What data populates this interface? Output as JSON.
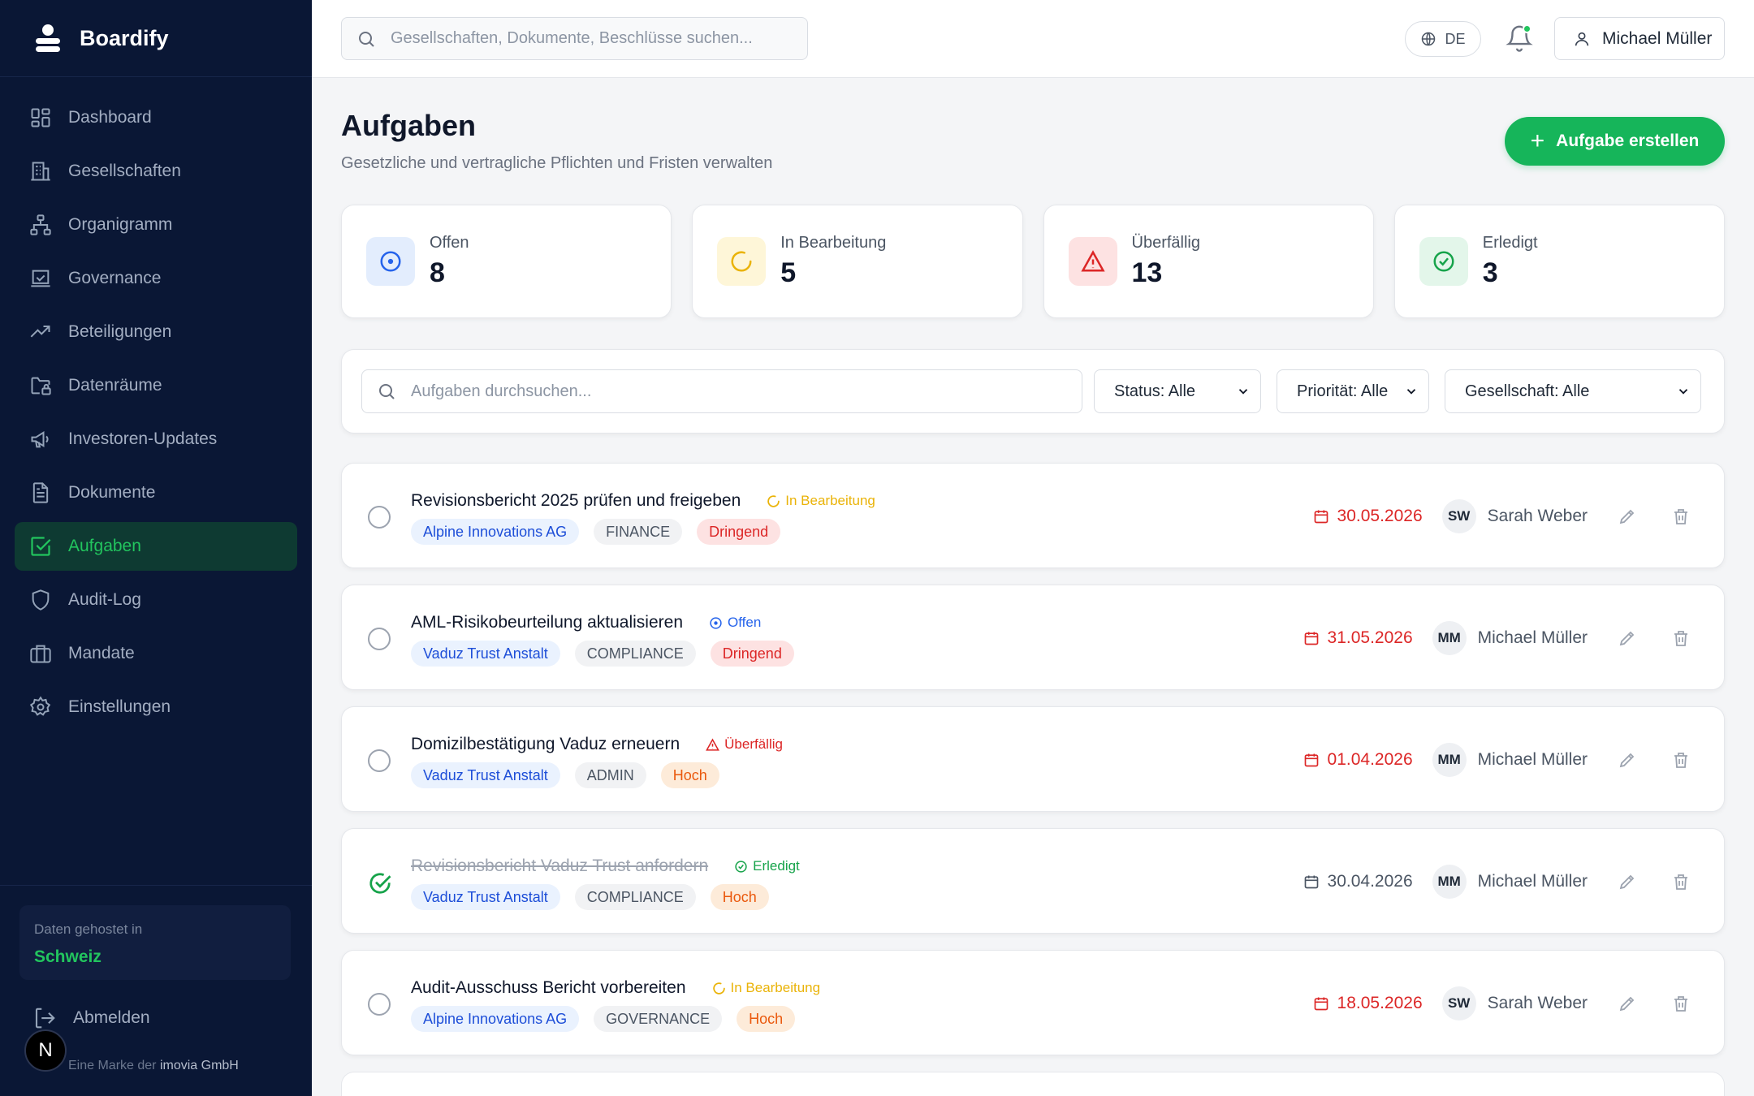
{
  "app": {
    "name": "Boardify"
  },
  "sidebar": {
    "items": [
      {
        "label": "Dashboard",
        "icon": "dashboard-icon"
      },
      {
        "label": "Gesellschaften",
        "icon": "building-icon"
      },
      {
        "label": "Organigramm",
        "icon": "org-chart-icon"
      },
      {
        "label": "Governance",
        "icon": "governance-icon"
      },
      {
        "label": "Beteiligungen",
        "icon": "trending-up-icon"
      },
      {
        "label": "Datenräume",
        "icon": "folder-lock-icon"
      },
      {
        "label": "Investoren-Updates",
        "icon": "megaphone-icon"
      },
      {
        "label": "Dokumente",
        "icon": "document-icon"
      },
      {
        "label": "Aufgaben",
        "icon": "checkbox-icon",
        "active": true
      },
      {
        "label": "Audit-Log",
        "icon": "shield-icon"
      },
      {
        "label": "Mandate",
        "icon": "briefcase-icon"
      },
      {
        "label": "Einstellungen",
        "icon": "gear-icon"
      }
    ],
    "hosting_label": "Daten gehostet in",
    "hosting_value": "Schweiz",
    "logout_label": "Abmelden",
    "brandline_prefix": "Eine Marke der",
    "brandline_company": "imovia GmbH",
    "badge_letter": "N"
  },
  "topbar": {
    "search_placeholder": "Gesellschaften, Dokumente, Beschlüsse suchen...",
    "language": "DE",
    "user_name": "Michael Müller"
  },
  "page": {
    "title": "Aufgaben",
    "subtitle": "Gesetzliche und vertragliche Pflichten und Fristen verwalten",
    "create_button": "Aufgabe erstellen"
  },
  "stats": [
    {
      "label": "Offen",
      "value": "8",
      "icon": "target-icon",
      "color": "#2563eb",
      "bg": "#e3edfd"
    },
    {
      "label": "In Bearbeitung",
      "value": "5",
      "icon": "loader-icon",
      "color": "#eab308",
      "bg": "#fef6d8"
    },
    {
      "label": "Überfällig",
      "value": "13",
      "icon": "alert-triangle-icon",
      "color": "#dc2626",
      "bg": "#fde2e2"
    },
    {
      "label": "Erledigt",
      "value": "3",
      "icon": "check-circle-icon",
      "color": "#16a34a",
      "bg": "#e3f6ea"
    }
  ],
  "filters": {
    "search_placeholder": "Aufgaben durchsuchen...",
    "status": "Status: Alle",
    "priority": "Priorität: Alle",
    "company": "Gesellschaft: Alle"
  },
  "tasks": [
    {
      "title": "Revisionsbericht 2025 prüfen und freigeben",
      "status": "In Bearbeitung",
      "status_color": "#eab308",
      "company": "Alpine Innovations AG",
      "category": "FINANCE",
      "priority": "Dringend",
      "due": "30.05.2026",
      "due_overdue": true,
      "initials": "SW",
      "assignee": "Sarah Weber",
      "done": false
    },
    {
      "title": "AML-Risikobeurteilung aktualisieren",
      "status": "Offen",
      "status_color": "#2563eb",
      "company": "Vaduz Trust Anstalt",
      "category": "COMPLIANCE",
      "priority": "Dringend",
      "due": "31.05.2026",
      "due_overdue": true,
      "initials": "MM",
      "assignee": "Michael Müller",
      "done": false
    },
    {
      "title": "Domizilbestätigung Vaduz erneuern",
      "status": "Überfällig",
      "status_color": "#dc2626",
      "company": "Vaduz Trust Anstalt",
      "category": "ADMIN",
      "priority": "Hoch",
      "due": "01.04.2026",
      "due_overdue": true,
      "initials": "MM",
      "assignee": "Michael Müller",
      "done": false
    },
    {
      "title": "Revisionsbericht Vaduz Trust anfordern",
      "status": "Erledigt",
      "status_color": "#16a34a",
      "company": "Vaduz Trust Anstalt",
      "category": "COMPLIANCE",
      "priority": "Hoch",
      "due": "30.04.2026",
      "due_overdue": false,
      "initials": "MM",
      "assignee": "Michael Müller",
      "done": true
    },
    {
      "title": "Audit-Ausschuss Bericht vorbereiten",
      "status": "In Bearbeitung",
      "status_color": "#eab308",
      "company": "Alpine Innovations AG",
      "category": "GOVERNANCE",
      "priority": "Hoch",
      "due": "18.05.2026",
      "due_overdue": true,
      "initials": "SW",
      "assignee": "Sarah Weber",
      "done": false
    }
  ]
}
